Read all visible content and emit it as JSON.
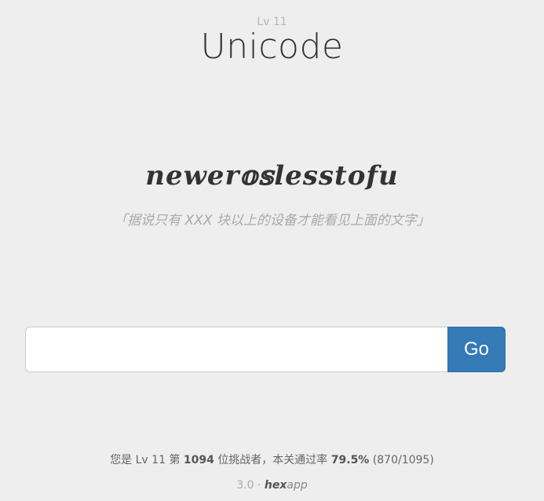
{
  "header": {
    "level": "Lv 11",
    "title": "Unicode"
  },
  "puzzle": {
    "text": "newer𝕠𝕤lesstofu",
    "hint": "「据说只有 XXX 块以上的设备才能看见上面的文字」"
  },
  "form": {
    "input_value": "",
    "go_label": "Go"
  },
  "stats": {
    "prefix": "您是 Lv 11 第",
    "rank": "1094",
    "middle": "位挑战者，本关通过率",
    "pass_rate": "79.5%",
    "ratio": "(870/1095)"
  },
  "footer": {
    "version": "3.0",
    "separator": "·",
    "brand_bold": "hex",
    "brand_rest": "app"
  },
  "colors": {
    "background": "#eeeeee",
    "accent": "#337ab7",
    "muted": "#aaaaaa"
  }
}
